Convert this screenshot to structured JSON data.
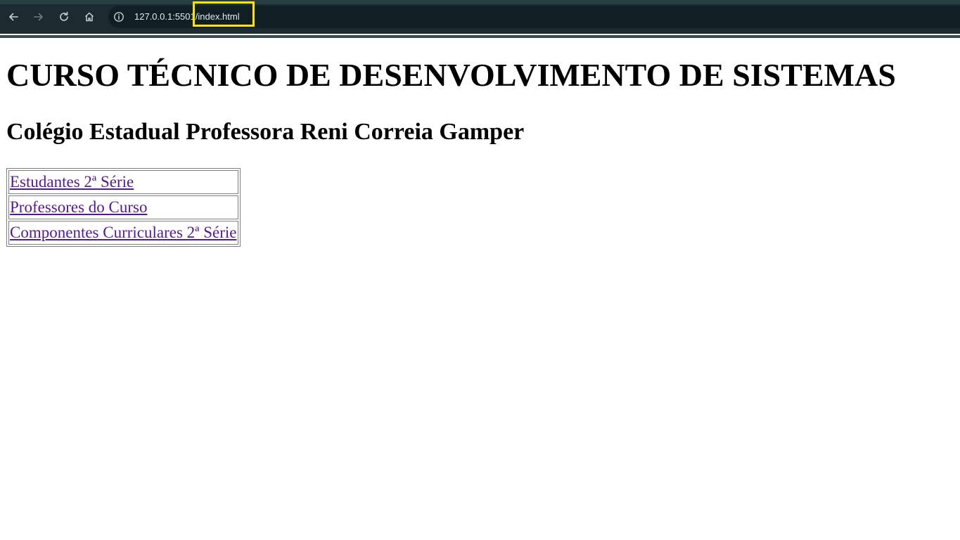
{
  "browser": {
    "url_host": "127.0.0.1:5501",
    "url_path": "/index.html",
    "icons": {
      "back": "arrow-left-icon",
      "forward": "arrow-right-icon",
      "reload": "reload-icon",
      "home": "home-icon",
      "info": "info-icon"
    },
    "highlight_color": "#ffe600"
  },
  "page": {
    "title": "CURSO TÉCNICO DE DESENVOLVIMENTO DE SISTEMAS",
    "subtitle": "Colégio Estadual Professora Reni Correia Gamper",
    "links": [
      {
        "label": "Estudantes 2ª Série"
      },
      {
        "label": "Professores do Curso"
      },
      {
        "label": "Componentes Curriculares 2ª Série"
      }
    ],
    "link_color": "#551a8b"
  }
}
